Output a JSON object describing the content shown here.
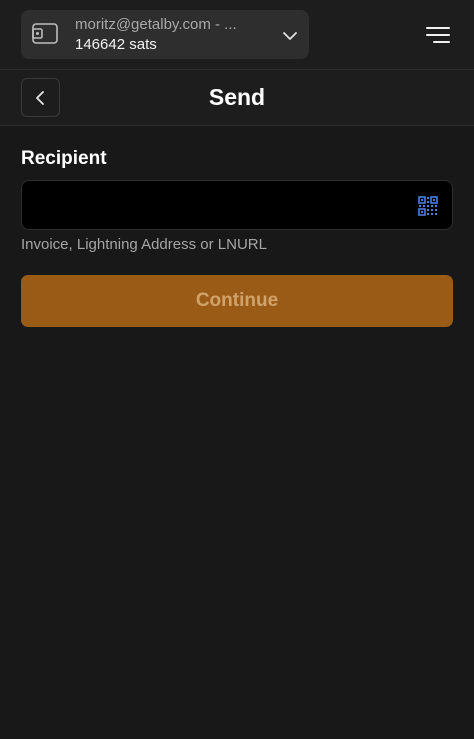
{
  "account": {
    "email": "moritz@getalby.com - ...",
    "balance": "146642 sats",
    "icons": {
      "wallet": "wallet-icon",
      "expand": "chevron-down-icon"
    }
  },
  "menu": {
    "icon": "hamburger-menu-icon"
  },
  "header": {
    "title": "Send",
    "back_icon": "chevron-left-icon"
  },
  "form": {
    "recipient_label": "Recipient",
    "recipient_value": "",
    "recipient_placeholder": "",
    "helper_text": "Invoice, Lightning Address or LNURL",
    "qr_icon": "qr-code-icon",
    "continue_label": "Continue"
  },
  "colors": {
    "background": "#181818",
    "bar": "#1d1d1d",
    "account_pill": "#2e2e2e",
    "input_bg": "#000000",
    "primary_button": "#9a5b17",
    "primary_button_text": "#d0a36b",
    "qr_icon": "#4a7fe0"
  }
}
